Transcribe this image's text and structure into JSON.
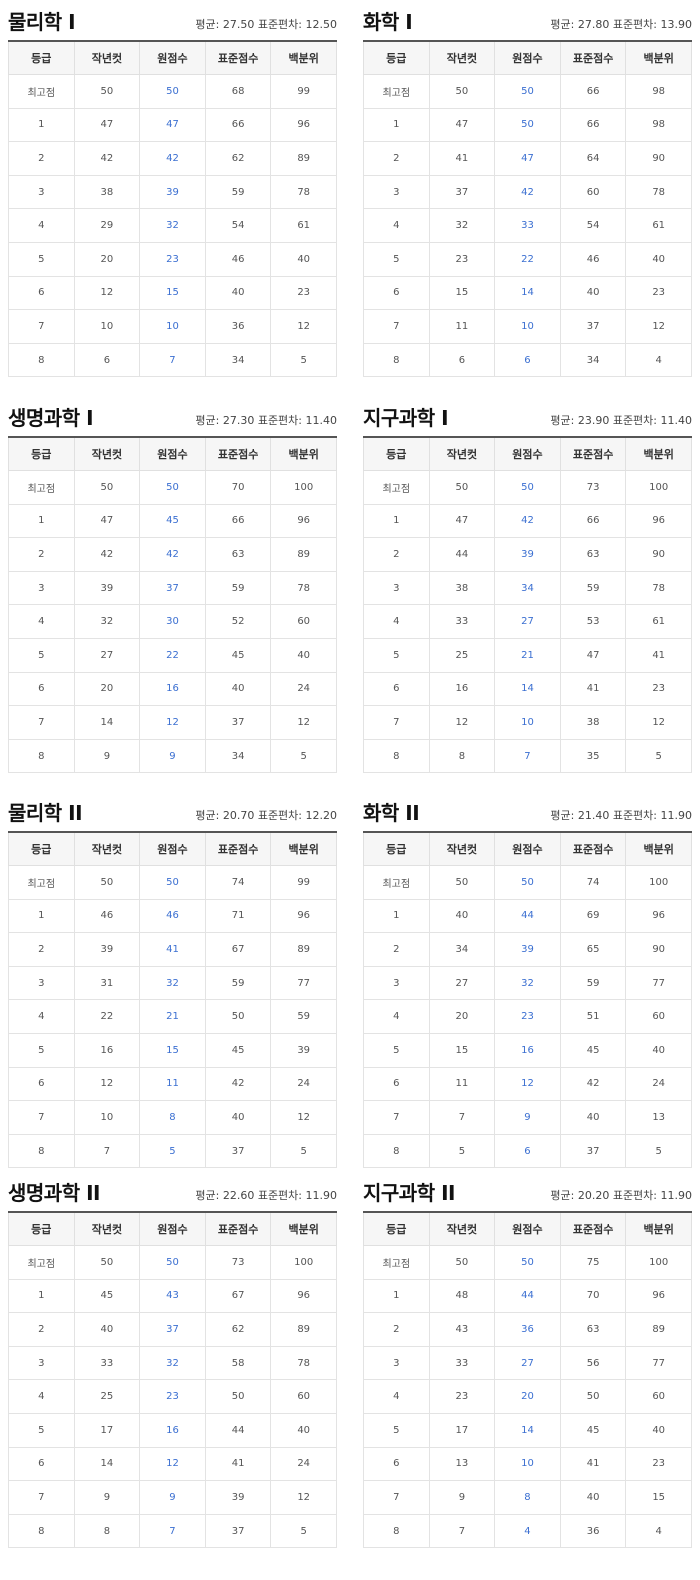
{
  "colors": {
    "raw_score": "#3b6fd1",
    "header_bg": "#f6f6f6",
    "border": "#e3e3e3"
  },
  "headers": [
    "등급",
    "작년컷",
    "원점수",
    "표준점수",
    "백분위"
  ],
  "panels": [
    {
      "title": "물리학 I",
      "stats": "평균: 27.50 표준편차: 12.50",
      "rows": [
        [
          "최고점",
          "50",
          "50",
          "68",
          "99"
        ],
        [
          "1",
          "47",
          "47",
          "66",
          "96"
        ],
        [
          "2",
          "42",
          "42",
          "62",
          "89"
        ],
        [
          "3",
          "38",
          "39",
          "59",
          "78"
        ],
        [
          "4",
          "29",
          "32",
          "54",
          "61"
        ],
        [
          "5",
          "20",
          "23",
          "46",
          "40"
        ],
        [
          "6",
          "12",
          "15",
          "40",
          "23"
        ],
        [
          "7",
          "10",
          "10",
          "36",
          "12"
        ],
        [
          "8",
          "6",
          "7",
          "34",
          "5"
        ]
      ]
    },
    {
      "title": "화학 I",
      "stats": "평균: 27.80 표준편차: 13.90",
      "rows": [
        [
          "최고점",
          "50",
          "50",
          "66",
          "98"
        ],
        [
          "1",
          "47",
          "50",
          "66",
          "98"
        ],
        [
          "2",
          "41",
          "47",
          "64",
          "90"
        ],
        [
          "3",
          "37",
          "42",
          "60",
          "78"
        ],
        [
          "4",
          "32",
          "33",
          "54",
          "61"
        ],
        [
          "5",
          "23",
          "22",
          "46",
          "40"
        ],
        [
          "6",
          "15",
          "14",
          "40",
          "23"
        ],
        [
          "7",
          "11",
          "10",
          "37",
          "12"
        ],
        [
          "8",
          "6",
          "6",
          "34",
          "4"
        ]
      ]
    },
    {
      "title": "생명과학 I",
      "stats": "평균: 27.30 표준편차: 11.40",
      "rows": [
        [
          "최고점",
          "50",
          "50",
          "70",
          "100"
        ],
        [
          "1",
          "47",
          "45",
          "66",
          "96"
        ],
        [
          "2",
          "42",
          "42",
          "63",
          "89"
        ],
        [
          "3",
          "39",
          "37",
          "59",
          "78"
        ],
        [
          "4",
          "32",
          "30",
          "52",
          "60"
        ],
        [
          "5",
          "27",
          "22",
          "45",
          "40"
        ],
        [
          "6",
          "20",
          "16",
          "40",
          "24"
        ],
        [
          "7",
          "14",
          "12",
          "37",
          "12"
        ],
        [
          "8",
          "9",
          "9",
          "34",
          "5"
        ]
      ]
    },
    {
      "title": "지구과학 I",
      "stats": "평균: 23.90 표준편차: 11.40",
      "rows": [
        [
          "최고점",
          "50",
          "50",
          "73",
          "100"
        ],
        [
          "1",
          "47",
          "42",
          "66",
          "96"
        ],
        [
          "2",
          "44",
          "39",
          "63",
          "90"
        ],
        [
          "3",
          "38",
          "34",
          "59",
          "78"
        ],
        [
          "4",
          "33",
          "27",
          "53",
          "61"
        ],
        [
          "5",
          "25",
          "21",
          "47",
          "41"
        ],
        [
          "6",
          "16",
          "14",
          "41",
          "23"
        ],
        [
          "7",
          "12",
          "10",
          "38",
          "12"
        ],
        [
          "8",
          "8",
          "7",
          "35",
          "5"
        ]
      ]
    },
    {
      "title": "물리학 II",
      "stats": "평균: 20.70 표준편차: 12.20",
      "rows": [
        [
          "최고점",
          "50",
          "50",
          "74",
          "99"
        ],
        [
          "1",
          "46",
          "46",
          "71",
          "96"
        ],
        [
          "2",
          "39",
          "41",
          "67",
          "89"
        ],
        [
          "3",
          "31",
          "32",
          "59",
          "77"
        ],
        [
          "4",
          "22",
          "21",
          "50",
          "59"
        ],
        [
          "5",
          "16",
          "15",
          "45",
          "39"
        ],
        [
          "6",
          "12",
          "11",
          "42",
          "24"
        ],
        [
          "7",
          "10",
          "8",
          "40",
          "12"
        ],
        [
          "8",
          "7",
          "5",
          "37",
          "5"
        ]
      ]
    },
    {
      "title": "화학 II",
      "stats": "평균: 21.40 표준편차: 11.90",
      "rows": [
        [
          "최고점",
          "50",
          "50",
          "74",
          "100"
        ],
        [
          "1",
          "40",
          "44",
          "69",
          "96"
        ],
        [
          "2",
          "34",
          "39",
          "65",
          "90"
        ],
        [
          "3",
          "27",
          "32",
          "59",
          "77"
        ],
        [
          "4",
          "20",
          "23",
          "51",
          "60"
        ],
        [
          "5",
          "15",
          "16",
          "45",
          "40"
        ],
        [
          "6",
          "11",
          "12",
          "42",
          "24"
        ],
        [
          "7",
          "7",
          "9",
          "40",
          "13"
        ],
        [
          "8",
          "5",
          "6",
          "37",
          "5"
        ]
      ]
    },
    {
      "title": "생명과학 II",
      "stats": "평균: 22.60 표준편차: 11.90",
      "rows": [
        [
          "최고점",
          "50",
          "50",
          "73",
          "100"
        ],
        [
          "1",
          "45",
          "43",
          "67",
          "96"
        ],
        [
          "2",
          "40",
          "37",
          "62",
          "89"
        ],
        [
          "3",
          "33",
          "32",
          "58",
          "78"
        ],
        [
          "4",
          "25",
          "23",
          "50",
          "60"
        ],
        [
          "5",
          "17",
          "16",
          "44",
          "40"
        ],
        [
          "6",
          "14",
          "12",
          "41",
          "24"
        ],
        [
          "7",
          "9",
          "9",
          "39",
          "12"
        ],
        [
          "8",
          "8",
          "7",
          "37",
          "5"
        ]
      ]
    },
    {
      "title": "지구과학 II",
      "stats": "평균: 20.20 표준편차: 11.90",
      "rows": [
        [
          "최고점",
          "50",
          "50",
          "75",
          "100"
        ],
        [
          "1",
          "48",
          "44",
          "70",
          "96"
        ],
        [
          "2",
          "43",
          "36",
          "63",
          "89"
        ],
        [
          "3",
          "33",
          "27",
          "56",
          "77"
        ],
        [
          "4",
          "23",
          "20",
          "50",
          "60"
        ],
        [
          "5",
          "17",
          "14",
          "45",
          "40"
        ],
        [
          "6",
          "13",
          "10",
          "41",
          "23"
        ],
        [
          "7",
          "9",
          "8",
          "40",
          "15"
        ],
        [
          "8",
          "7",
          "4",
          "36",
          "4"
        ]
      ]
    }
  ]
}
